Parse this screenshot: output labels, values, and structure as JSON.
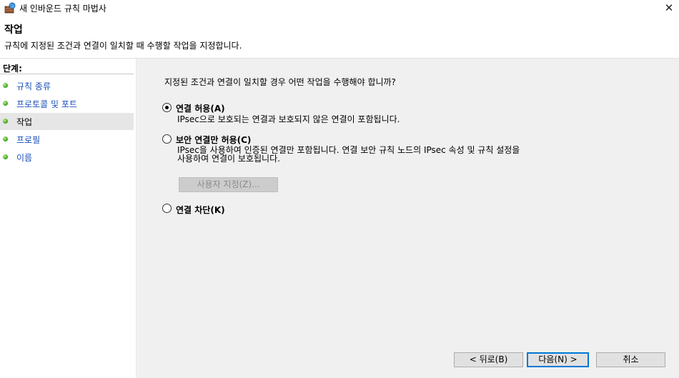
{
  "window": {
    "title": "새 인바운드 규칙 마법사",
    "close_glyph": "✕"
  },
  "header": {
    "title": "작업",
    "description": "규칙에 지정된 조건과 연결이 일치할 때 수행할 작업을 지정합니다."
  },
  "steps": {
    "heading": "단계:",
    "items": [
      {
        "label": "규칙 종류"
      },
      {
        "label": "프로토콜 및 포트"
      },
      {
        "label": "작업",
        "current": true
      },
      {
        "label": "프로필"
      },
      {
        "label": "이름"
      }
    ]
  },
  "main": {
    "question": "지정된 조건과 연결이 일치할 경우 어떤 작업을 수행해야 합니까?",
    "options": [
      {
        "label": "연결 허용(A)",
        "selected": true,
        "desc": [
          "IPsec으로 보호되는 연결과 보호되지 않은 연결이 포함됩니다."
        ]
      },
      {
        "label": "보안 연결만 허용(C)",
        "selected": false,
        "desc": [
          "IPsec을 사용하여 인증된 연결만 포함됩니다. 연결 보안 규칙 노드의 IPsec 속성 및 규칙 설정을",
          "사용하여 연결이 보호됩니다."
        ]
      },
      {
        "label": "연결 차단(K)",
        "selected": false,
        "desc": []
      }
    ],
    "customize_label": "사용자 지정(Z)..."
  },
  "footer": {
    "back_label": "< 뒤로(B)",
    "next_label": "다음(N) >",
    "cancel_label": "취소"
  }
}
